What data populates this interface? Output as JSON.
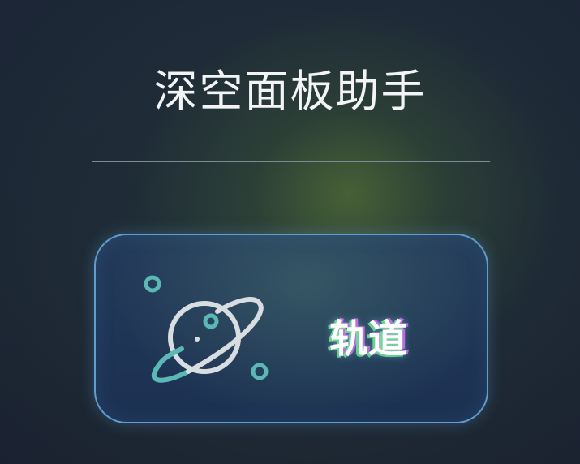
{
  "header": {
    "title": "深空面板助手"
  },
  "card": {
    "label": "轨道",
    "icon": "planet-icon"
  },
  "colors": {
    "card_border": "#5f9ed0",
    "icon_ring": "#5bb8b4",
    "icon_planet": "#d8dde2",
    "label_glow_green": "#6ee696",
    "label_glow_purple": "#dc6eff"
  }
}
